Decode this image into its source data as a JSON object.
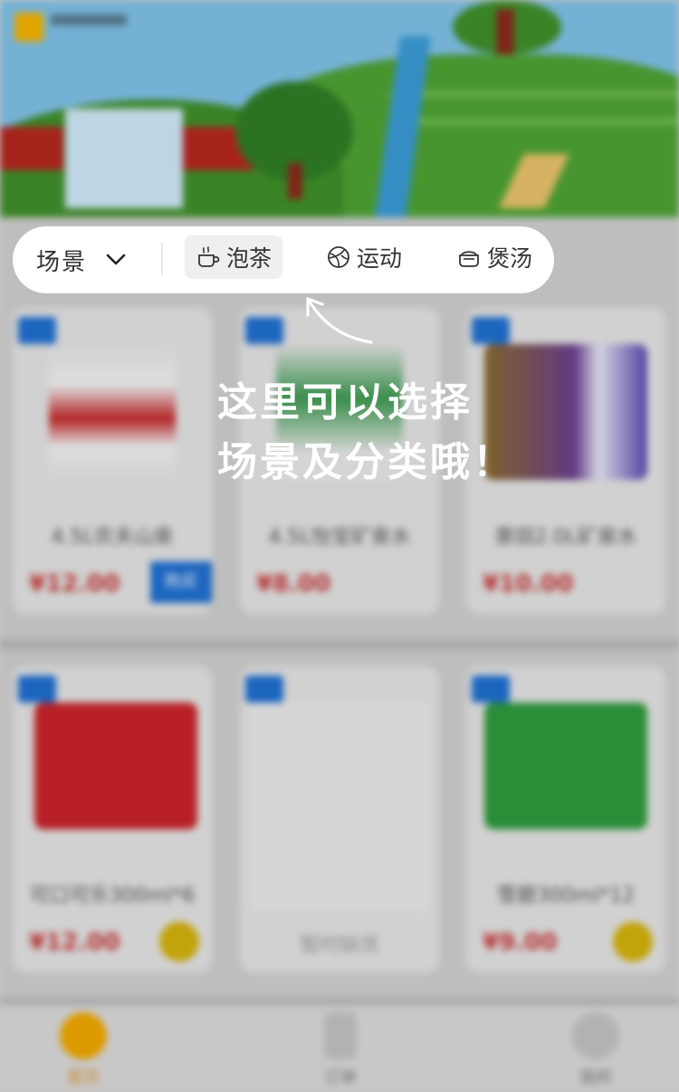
{
  "scene_selector": {
    "label": "场景",
    "chevron_icon": "chevron-down-icon"
  },
  "scene_chips": [
    {
      "label": "泡茶",
      "icon": "tea-cup-icon",
      "active": true
    },
    {
      "label": "运动",
      "icon": "ball-icon",
      "active": false
    },
    {
      "label": "煲汤",
      "icon": "soup-pot-icon",
      "active": false
    }
  ],
  "guide": {
    "line1": "这里可以选择",
    "line2": "场景及分类哦！"
  },
  "products_row1": [
    {
      "name": "4.5L农夫山泉",
      "price": "¥12.00",
      "action": "购买"
    },
    {
      "name": "4.5L怡宝矿泉水",
      "price": "¥8.00"
    },
    {
      "name": "景田2.0L矿泉水",
      "price": "¥10.00"
    }
  ],
  "products_row2": [
    {
      "name": "可口可乐300ml*6",
      "price": "¥12.00"
    },
    {
      "name": "暂时缺货",
      "price": ""
    },
    {
      "name": "雪碧300ml*12",
      "price": "¥9.00"
    }
  ],
  "tabbar": [
    {
      "label": "首页",
      "icon": "home-icon",
      "active": true
    },
    {
      "label": "订单",
      "icon": "order-icon",
      "active": false
    },
    {
      "label": "我的",
      "icon": "profile-icon",
      "active": false
    }
  ],
  "colors": {
    "accent": "#f5b400",
    "price": "#c63636",
    "tag": "#1f6fd1"
  }
}
